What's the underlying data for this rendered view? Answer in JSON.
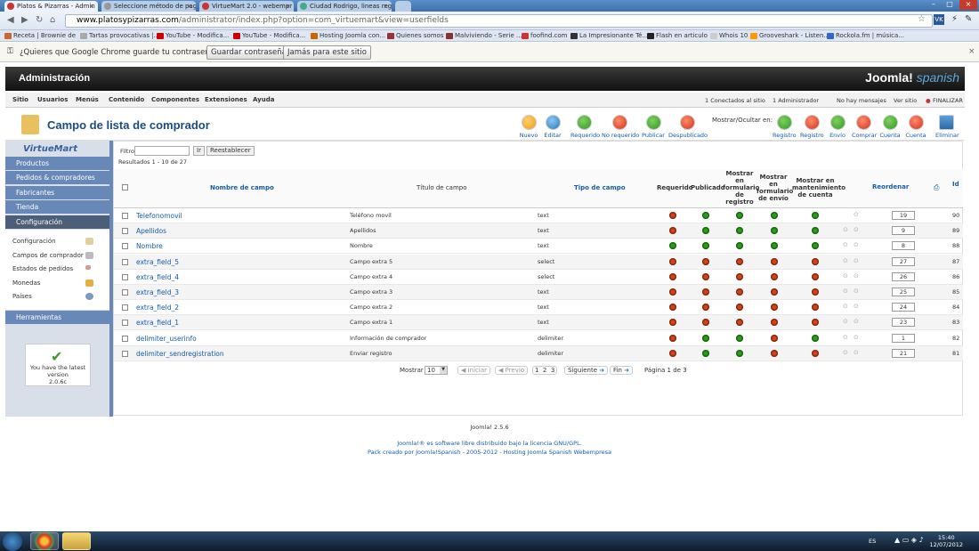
{
  "browser": {
    "tabs": [
      {
        "label": "Platos & Pizarras - Admin",
        "active": true
      },
      {
        "label": "Seleccione método de pag"
      },
      {
        "label": "VirtueMart 2.0 - webempr"
      },
      {
        "label": "Ciudad Rodrigo, lineas reg"
      }
    ],
    "url_host": "www.platosypizarras.com",
    "url_path": "/administrator/index.php?option=com_virtuemart&view=userfields",
    "bookmarks": [
      "Receta | Brownie de",
      "Tartas provocativas |...",
      "YouTube - Modifica...",
      "YouTube - Modifica...",
      "Hosting Joomla con...",
      "Quienes somos",
      "Malviviendo - Serie ...",
      "foofind.com",
      "La Impresionante Té...",
      "Flash en articulo",
      "Whois 10",
      "Grooveshark - Listen...",
      "Rockola.fm | música..."
    ],
    "password_prompt": "¿Quieres que Google Chrome guarde tu contraseña?",
    "save_password": "Guardar contraseña",
    "never_save": "Jamás para este sitio"
  },
  "admin": {
    "title": "Administración",
    "logo_main": "Joomla!",
    "logo_sub": "spanish",
    "menu": [
      "Sitio",
      "Usuarios",
      "Menús",
      "Contenido",
      "Componentes",
      "Extensiones",
      "Ayuda"
    ],
    "status": {
      "connected": "1 Conectados al sitio",
      "admins": "1 Administrador",
      "messages": "No hay mensajes",
      "view_site": "Ver sitio",
      "logout": "FINALIZAR"
    }
  },
  "page": {
    "title": "Campo de lista de comprador",
    "toolbar": [
      {
        "label": "Nuevo",
        "color": "o"
      },
      {
        "label": "Editar",
        "color": "b"
      },
      {
        "label": "Requerido",
        "color": "g"
      },
      {
        "label": "No requerido",
        "color": "r"
      },
      {
        "label": "Publicar",
        "color": "g"
      },
      {
        "label": "Despublicado",
        "color": "r"
      }
    ],
    "show_hide_label": "Mostrar/Ocultar en:",
    "toolbar_right": [
      {
        "label": "Registro",
        "color": "g"
      },
      {
        "label": "Registro",
        "color": "r"
      },
      {
        "label": "Envío",
        "color": "g"
      },
      {
        "label": "Comprar",
        "color": "r"
      },
      {
        "label": "Cuenta",
        "color": "g"
      },
      {
        "label": "Cuenta",
        "color": "r"
      },
      {
        "label": "Eliminar",
        "color": "t"
      }
    ]
  },
  "sidebar": {
    "logo": "VirtueMart",
    "sections": [
      "Productos",
      "Pedidos & compradores",
      "Fabricantes",
      "Tienda",
      "Configuración"
    ],
    "config_items": [
      "Configuración",
      "Campos de comprador",
      "Estados de pedidos",
      "Monedas",
      "Países"
    ],
    "tools": "Herramientas",
    "version_text": "You have the latest version",
    "version": "2.0.6c"
  },
  "filter": {
    "label": "Filtro:",
    "go": "Ir",
    "reset": "Reestablecer",
    "results": "Resultados 1 - 10 de 27"
  },
  "table": {
    "headers": {
      "name": "Nombre de campo",
      "title": "Título de campo",
      "type": "Tipo de campo",
      "required": "Requerido",
      "published": "Publicado",
      "show_reg": "Mostrar en formulario de registro",
      "show_ship": "Mostrar en formulario de envío",
      "show_acct": "Mostrar en mantenimiento de cuenta",
      "reorder": "Reordenar",
      "id": "Id"
    },
    "rows": [
      {
        "name": "Telefonomovil",
        "title": "Teléfono movil",
        "type": "text",
        "req": "r",
        "pub": "g",
        "reg": "g",
        "ship": "g",
        "acct": "g",
        "order": "19",
        "id": "90"
      },
      {
        "name": "Apellidos",
        "title": "Apellidos",
        "type": "text",
        "req": "r",
        "pub": "g",
        "reg": "g",
        "ship": "g",
        "acct": "g",
        "order": "9",
        "id": "89"
      },
      {
        "name": "Nombre",
        "title": "Nombre",
        "type": "text",
        "req": "g",
        "pub": "g",
        "reg": "g",
        "ship": "g",
        "acct": "g",
        "order": "8",
        "id": "88"
      },
      {
        "name": "extra_field_5",
        "title": "Campo extra 5",
        "type": "select",
        "req": "r",
        "pub": "r",
        "reg": "r",
        "ship": "r",
        "acct": "r",
        "order": "27",
        "id": "87"
      },
      {
        "name": "extra_field_4",
        "title": "Campo extra 4",
        "type": "select",
        "req": "r",
        "pub": "r",
        "reg": "r",
        "ship": "r",
        "acct": "r",
        "order": "26",
        "id": "86"
      },
      {
        "name": "extra_field_3",
        "title": "Campo extra 3",
        "type": "text",
        "req": "r",
        "pub": "r",
        "reg": "r",
        "ship": "r",
        "acct": "r",
        "order": "25",
        "id": "85"
      },
      {
        "name": "extra_field_2",
        "title": "Campo extra 2",
        "type": "text",
        "req": "r",
        "pub": "r",
        "reg": "r",
        "ship": "r",
        "acct": "r",
        "order": "24",
        "id": "84"
      },
      {
        "name": "extra_field_1",
        "title": "Campo extra 1",
        "type": "text",
        "req": "r",
        "pub": "r",
        "reg": "r",
        "ship": "r",
        "acct": "r",
        "order": "23",
        "id": "83"
      },
      {
        "name": "delimiter_userinfo",
        "title": "Información de comprador",
        "type": "delimiter",
        "req": "r",
        "pub": "g",
        "reg": "g",
        "ship": "r",
        "acct": "g",
        "order": "1",
        "id": "82"
      },
      {
        "name": "delimiter_sendregistration",
        "title": "Enviar registro",
        "type": "delimiter",
        "req": "r",
        "pub": "g",
        "reg": "g",
        "ship": "r",
        "acct": "r",
        "order": "21",
        "id": "81"
      }
    ]
  },
  "pager": {
    "show": "Mostrar #",
    "limit": "10",
    "start": "Iniciar",
    "prev": "Previo",
    "pages": [
      "1",
      "2",
      "3"
    ],
    "next": "Siguiente",
    "end": "Fin",
    "page_of": "Página 1 de 3"
  },
  "footer": {
    "version": "Joomla! 2.5.6",
    "license": "Joomla!® es software libre distribuido bajo la licencia GNU/GPL.",
    "pack": "Pack creado por Joomla!Spanish - 2005-2012 - Hosting Joomla Spanish Webempresa"
  },
  "taskbar": {
    "lang": "ES",
    "time": "15:40",
    "date": "12/07/2012"
  }
}
